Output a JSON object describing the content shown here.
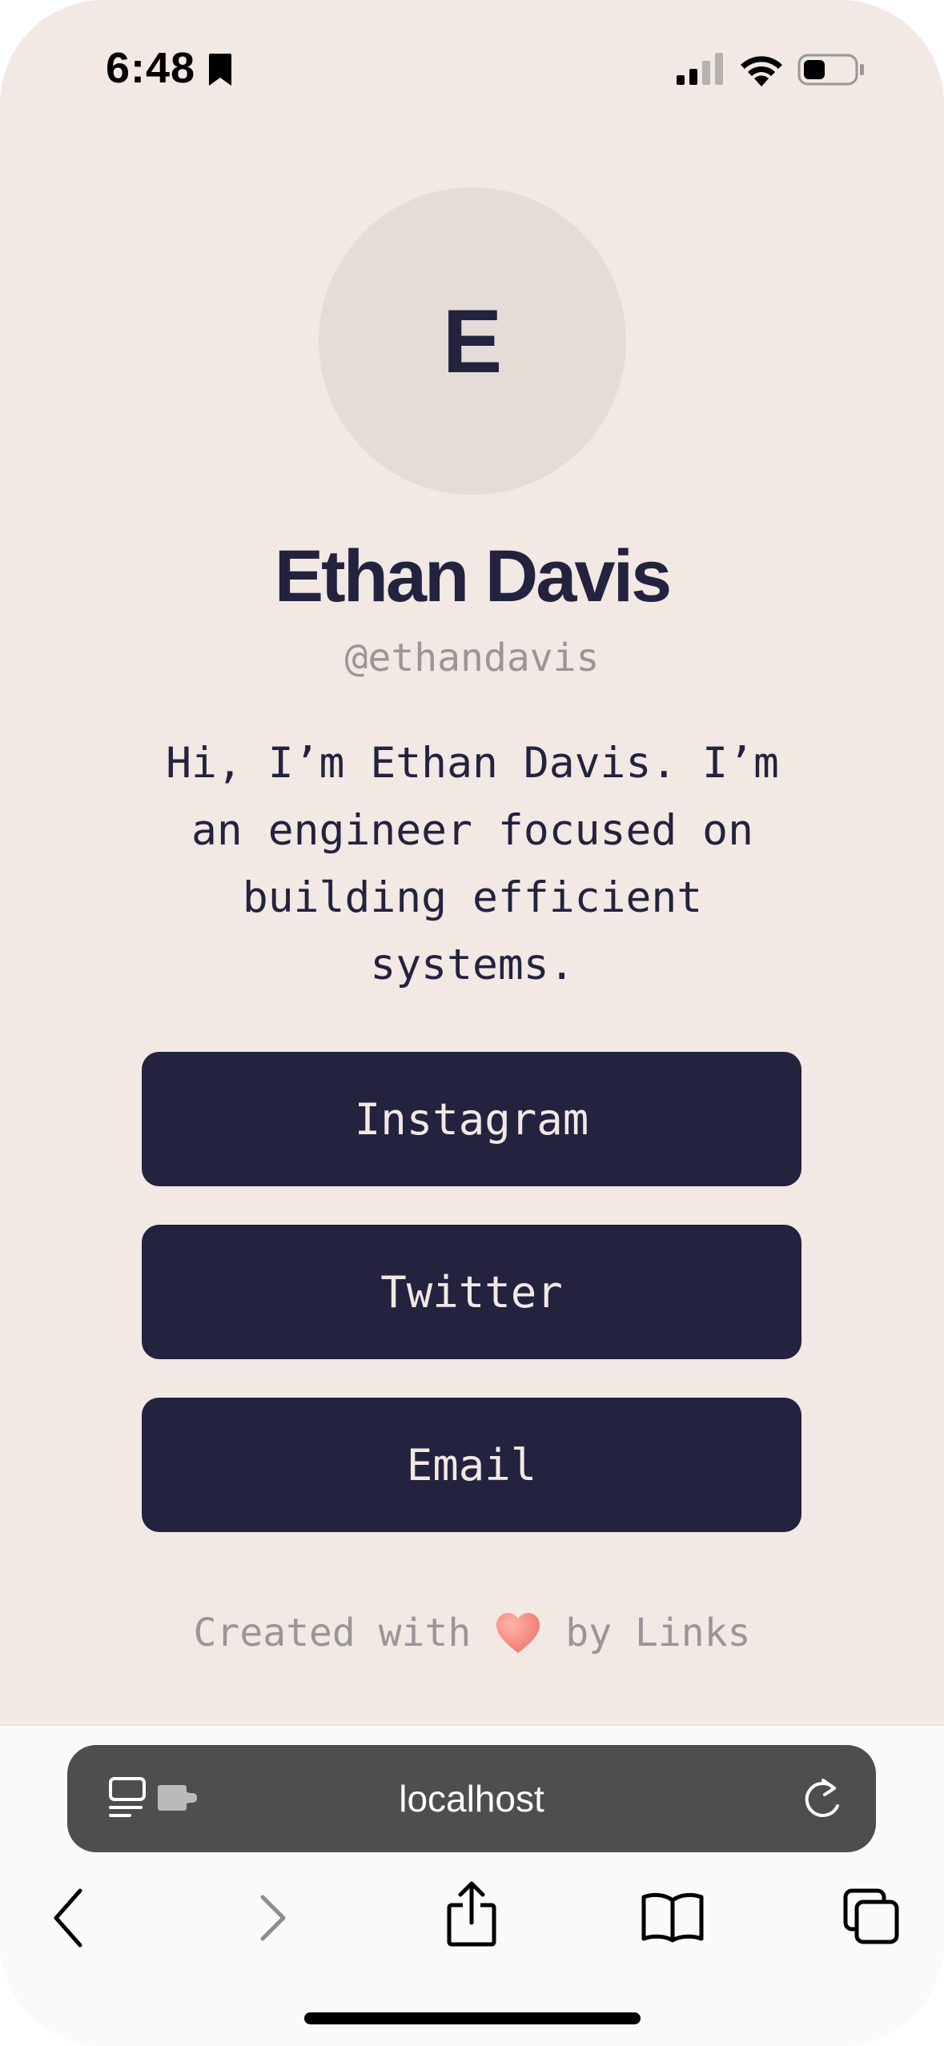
{
  "status_bar": {
    "time": "6:48",
    "icons": [
      "bookmark-icon",
      "cellular-signal-icon",
      "wifi-icon",
      "battery-icon"
    ]
  },
  "profile": {
    "avatar_initial": "E",
    "name": "Ethan Davis",
    "handle": "@ethandavis",
    "bio": "Hi, I’m Ethan Davis. I’m an engineer focused on building efficient systems."
  },
  "links": [
    {
      "label": "Instagram"
    },
    {
      "label": "Twitter"
    },
    {
      "label": "Email"
    }
  ],
  "footer": {
    "prefix": "Created with",
    "suffix": "by Links",
    "icon": "heart-icon"
  },
  "browser": {
    "url": "localhost",
    "icons": [
      "page-menu-icon",
      "extension-icon",
      "reload-icon",
      "back-icon",
      "forward-icon",
      "share-icon",
      "bookmarks-icon",
      "tabs-icon"
    ]
  },
  "colors": {
    "background": "#f2e8e4",
    "accent": "#23233f",
    "muted_text": "#9b9597",
    "address_bar": "#504e4c",
    "heart": "#f4827b"
  }
}
